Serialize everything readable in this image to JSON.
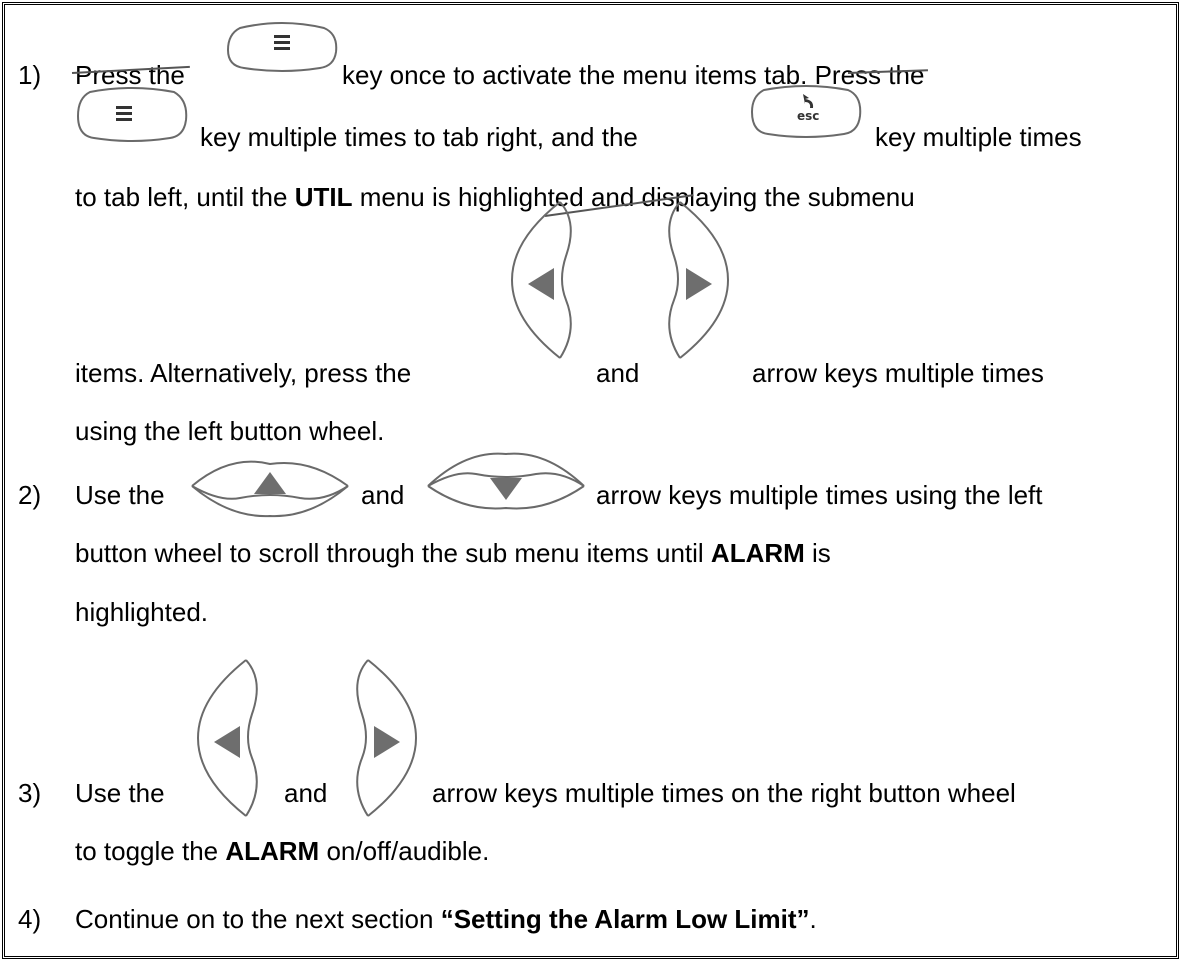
{
  "steps": [
    {
      "num": "1)",
      "t1": "Press the",
      "t2": "key once to activate the menu items tab.  Press the",
      "t3": "key multiple times to tab right, and the",
      "t4": "key multiple times",
      "t5a": "to tab left, until the ",
      "t5b": "UTIL",
      "t5c": " menu is highlighted and displaying the submenu",
      "t6a": "items.  Alternatively, press the",
      "t6b": "and",
      "t6c": "arrow keys multiple times",
      "t7": "using the left button wheel."
    },
    {
      "num": "2)",
      "t1": "Use the",
      "t2": "and",
      "t3": "arrow keys multiple times using the left",
      "t4a": "button wheel to scroll through the sub menu items until ",
      "t4b": "ALARM",
      "t4c": " is",
      "t5": "highlighted."
    },
    {
      "num": "3)",
      "t1": "Use the",
      "t2": "and",
      "t3": "arrow keys multiple times on the right button wheel",
      "t4a": "to toggle the ",
      "t4b": "ALARM",
      "t4c": " on/off/audible."
    },
    {
      "num": "4)",
      "t1": "Continue on to the next section ",
      "t2": "“Setting the Alarm Low Limit”",
      "t3": "."
    }
  ],
  "keys": {
    "menu_key": "menu-icon",
    "esc_key_label": "esc",
    "left_key": "left-arrow-key",
    "right_key": "right-arrow-key",
    "up_key": "up-arrow-key",
    "down_key": "down-arrow-key"
  },
  "colors": {
    "key_glyph": "#6e6e6e",
    "key_outline": "#6a6a6a",
    "border": "#000000"
  }
}
